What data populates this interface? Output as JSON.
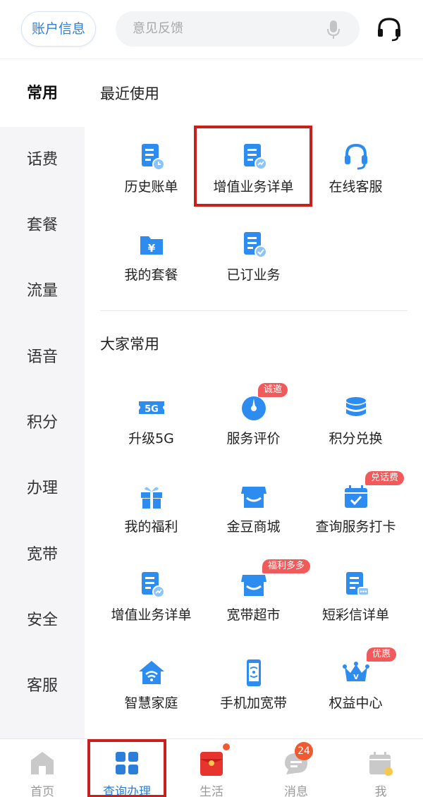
{
  "header": {
    "account_label": "账户信息",
    "search_placeholder": "意见反馈"
  },
  "sidebar": {
    "items": [
      {
        "label": "常用",
        "active": true
      },
      {
        "label": "话费"
      },
      {
        "label": "套餐"
      },
      {
        "label": "流量"
      },
      {
        "label": "语音"
      },
      {
        "label": "积分"
      },
      {
        "label": "办理"
      },
      {
        "label": "宽带"
      },
      {
        "label": "安全"
      },
      {
        "label": "客服"
      }
    ]
  },
  "recent": {
    "title": "最近使用",
    "items": [
      {
        "label": "历史账单",
        "icon": "bill-clock-icon"
      },
      {
        "label": "增值业务详单",
        "icon": "document-chart-icon",
        "highlighted": true
      },
      {
        "label": "在线客服",
        "icon": "headset-icon"
      },
      {
        "label": "我的套餐",
        "icon": "yuan-folder-icon"
      },
      {
        "label": "已订业务",
        "icon": "document-check-icon"
      }
    ]
  },
  "popular": {
    "title": "大家常用",
    "items": [
      {
        "label": "升级5G",
        "icon": "5g-ticket-icon"
      },
      {
        "label": "服务评价",
        "icon": "compass-icon",
        "badge": "诚邀"
      },
      {
        "label": "积分兑换",
        "icon": "coin-stack-icon"
      },
      {
        "label": "我的福利",
        "icon": "gift-icon"
      },
      {
        "label": "金豆商城",
        "icon": "store-icon"
      },
      {
        "label": "查询服务打卡",
        "icon": "calendar-check-icon",
        "badge": "兑话费"
      },
      {
        "label": "增值业务详单",
        "icon": "document-chart-icon"
      },
      {
        "label": "宽带超市",
        "icon": "shop-icon",
        "badge": "福利多多"
      },
      {
        "label": "短彩信详单",
        "icon": "document-message-icon"
      },
      {
        "label": "智慧家庭",
        "icon": "smart-home-icon"
      },
      {
        "label": "手机加宽带",
        "icon": "phone-signal-icon"
      },
      {
        "label": "权益中心",
        "icon": "crown-icon",
        "badge": "优惠"
      }
    ]
  },
  "tabbar": {
    "items": [
      {
        "label": "首页",
        "icon": "home-icon"
      },
      {
        "label": "查询办理",
        "icon": "grid-icon",
        "active": true
      },
      {
        "label": "生活",
        "icon": "red-envelope-icon"
      },
      {
        "label": "消息",
        "icon": "message-icon",
        "badge": "24"
      },
      {
        "label": "我",
        "icon": "calendar-sign-icon"
      }
    ]
  },
  "colors": {
    "accent": "#2b7fd8",
    "icon_blue": "#2d8cf0",
    "badge_red": "#f05a5a",
    "highlight_frame": "#c8201c"
  }
}
